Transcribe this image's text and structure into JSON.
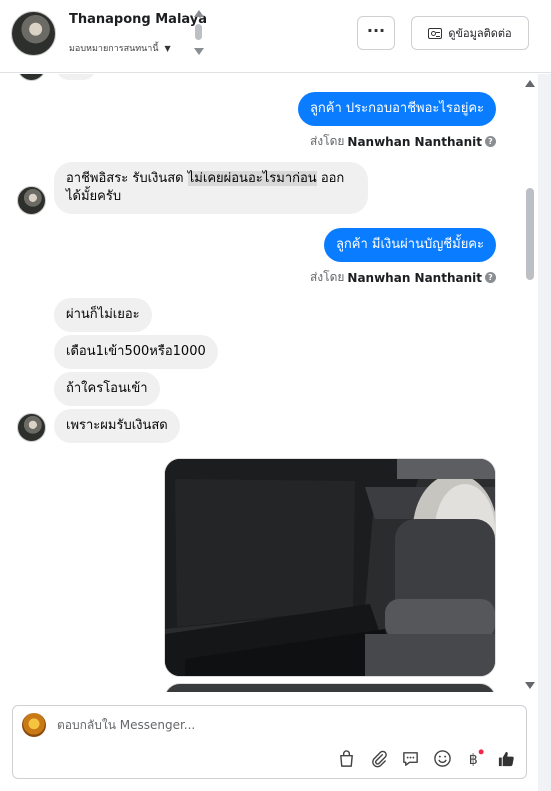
{
  "header": {
    "contact_name": "Thanapong Malaya",
    "assign_label": "มอบหมายการสนทนานี้",
    "more_label": "···",
    "contact_info_label": "ดูข้อมูลติดต่อ"
  },
  "messages": [
    {
      "id": "m1",
      "direction": "out",
      "text": "ลูกค้า ประกอบอาชีพอะไรอยู่คะ",
      "sent_by_prefix": "ส่งโดย",
      "sent_by_name": "Nanwhan Nanthanit"
    },
    {
      "id": "m2",
      "direction": "in",
      "text_before": "อาชีพอิสระ รับเงินสด ",
      "text_highlight": "ไม่เคยผ่อนอะไรมาก่อน",
      "text_after": " ออกได้มั้ยครับ"
    },
    {
      "id": "m3",
      "direction": "out",
      "text": "ลูกค้า มีเงินผ่านบัญชีมั้ยคะ",
      "sent_by_prefix": "ส่งโดย",
      "sent_by_name": "Nanwhan Nanthanit"
    },
    {
      "id": "m4",
      "direction": "in",
      "text": "ผ่านก็ไม่เยอะ"
    },
    {
      "id": "m5",
      "direction": "in",
      "text": "เดือน1เข้า500หรือ1000"
    },
    {
      "id": "m6",
      "direction": "in",
      "text": "ถ้าใครโอนเข้า"
    },
    {
      "id": "m7",
      "direction": "in",
      "text": "เพราะผมรับเงินสด"
    }
  ],
  "composer": {
    "placeholder": "ตอบกลับใน Messenger...",
    "tools": [
      "shop-bag-icon",
      "paperclip-icon",
      "saved-reply-icon",
      "emoji-icon",
      "baht-icon",
      "like-icon"
    ]
  },
  "colors": {
    "outgoing_bubble": "#0a7cff",
    "incoming_bubble": "#f0f0f0",
    "notification_dot": "#f02849"
  }
}
